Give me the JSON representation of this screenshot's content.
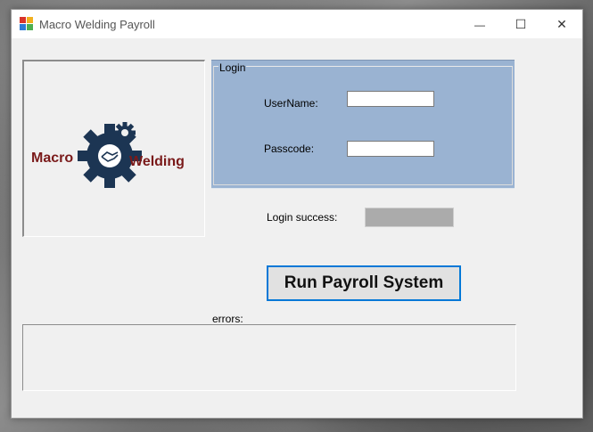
{
  "window": {
    "title": "Macro Welding Payroll",
    "controls": {
      "minimize": "—",
      "maximize": "☐",
      "close": "✕"
    }
  },
  "logo": {
    "left_text": "Macro",
    "right_text": "Welding"
  },
  "login": {
    "group_label": "Login",
    "username_label": "UserName:",
    "username_value": "",
    "passcode_label": "Passcode:",
    "passcode_value": ""
  },
  "status": {
    "success_label": "Login success:",
    "success_value": ""
  },
  "actions": {
    "run_label": "Run Payroll System"
  },
  "errors": {
    "label": "errors:",
    "value": ""
  },
  "colors": {
    "login_panel": "#9ab3d2",
    "logo_text": "#7a1a1a",
    "gear": "#1c3553",
    "button_border": "#0078d7"
  }
}
